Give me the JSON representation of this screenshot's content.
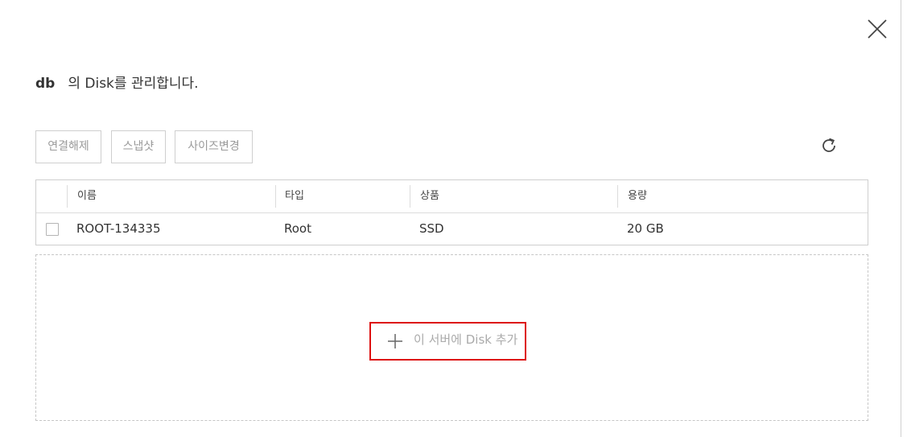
{
  "dialog": {
    "server_name": "db",
    "title_suffix": "의 Disk를 관리합니다."
  },
  "icons": {
    "close": "close-icon",
    "refresh": "refresh-icon",
    "add": "plus-icon"
  },
  "toolbar": {
    "detach_label": "연결해제",
    "snapshot_label": "스냅샷",
    "resize_label": "사이즈변경"
  },
  "table": {
    "columns": [
      "이름",
      "타입",
      "상품",
      "용량"
    ],
    "rows": [
      {
        "name": "ROOT-134335",
        "type": "Root",
        "product": "SSD",
        "size": "20 GB",
        "checked": false
      }
    ]
  },
  "add_disk": {
    "label": "이 서버에 Disk 추가"
  },
  "colors": {
    "highlight_border": "#dd1111",
    "border": "#cfcfcf",
    "muted_text": "#9a9a9a"
  }
}
